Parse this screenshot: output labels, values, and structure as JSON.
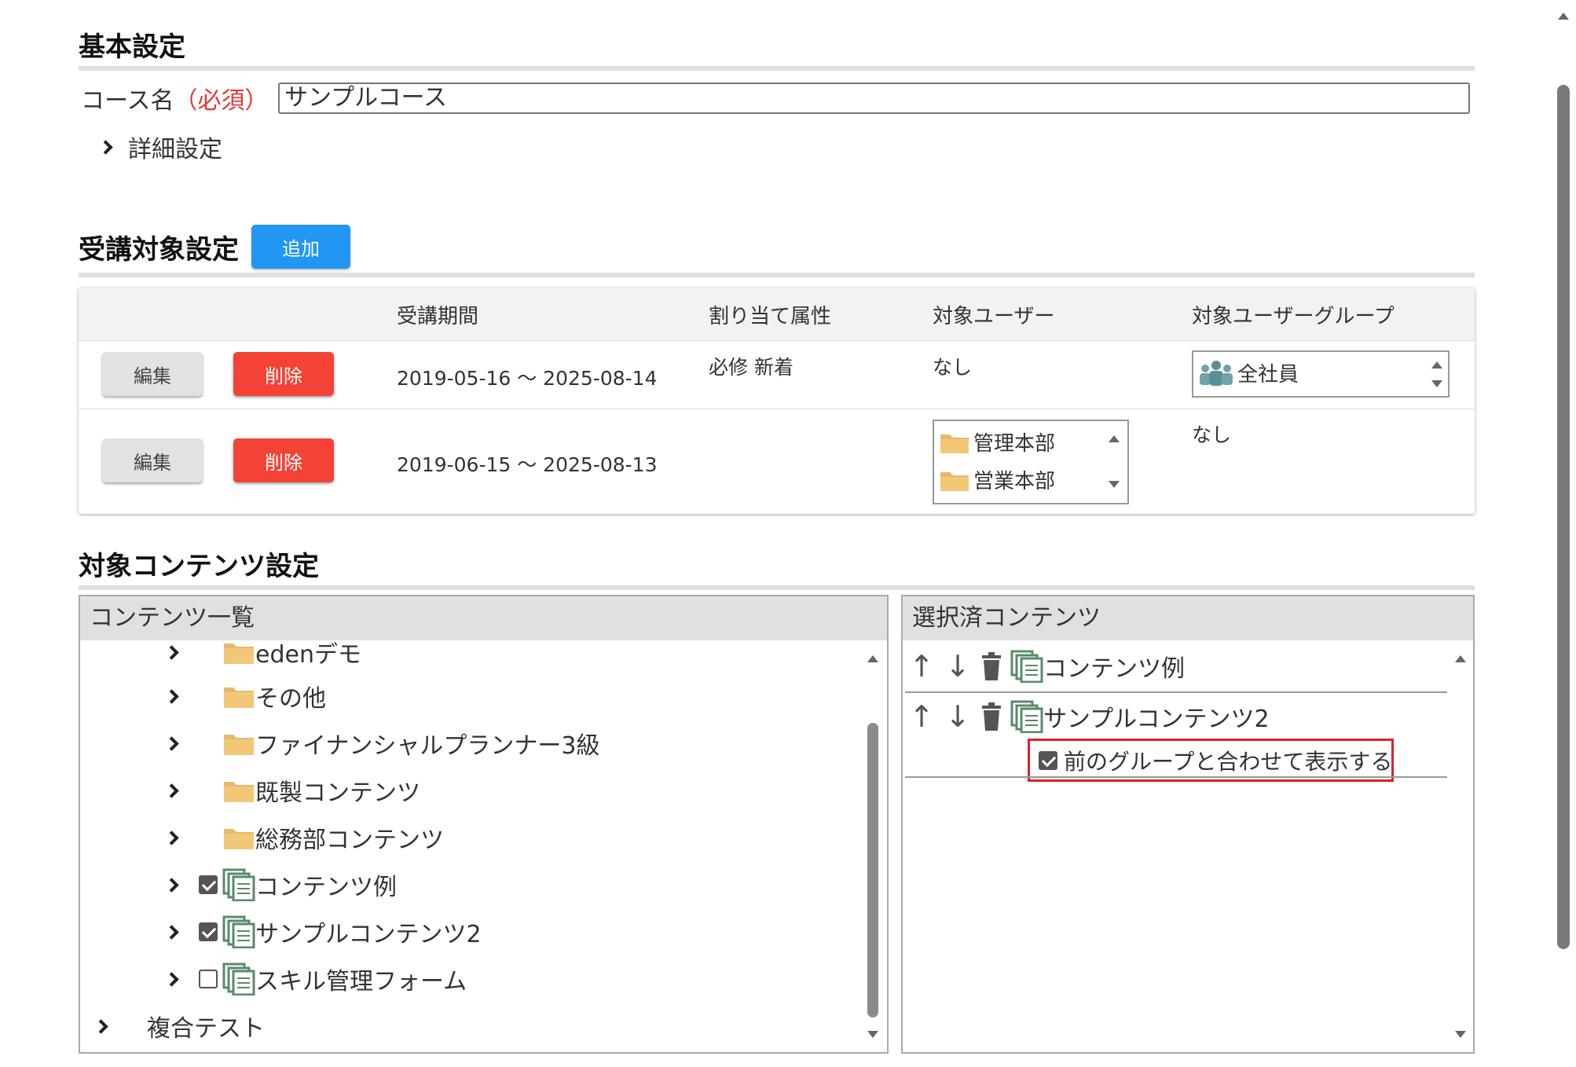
{
  "basic": {
    "title": "基本設定",
    "course_label": "コース名",
    "required_label": "（必須）",
    "course_value": "サンプルコース",
    "detail_label": "詳細設定"
  },
  "target": {
    "title": "受講対象設定",
    "add_label": "追加",
    "headers": [
      "受講期間",
      "割り当て属性",
      "対象ユーザー",
      "対象ユーザーグループ"
    ],
    "edit_label": "編集",
    "delete_label": "削除",
    "rows": [
      {
        "period": "2019-05-16 ～ 2025-08-14",
        "attribute": "必修 新着",
        "users": "なし",
        "group_items": [
          "全社員"
        ]
      },
      {
        "period": "2019-06-15 ～ 2025-08-13",
        "attribute": "",
        "user_items": [
          "管理本部",
          "営業本部"
        ],
        "groups": "なし"
      }
    ]
  },
  "contents": {
    "title": "対象コンテンツ設定",
    "list_header": "コンテンツ一覧",
    "selected_header": "選択済コンテンツ",
    "tree": [
      {
        "label": "edenデモ",
        "type": "folder"
      },
      {
        "label": "その他",
        "type": "folder"
      },
      {
        "label": "ファイナンシャルプランナー3級",
        "type": "folder"
      },
      {
        "label": "既製コンテンツ",
        "type": "folder"
      },
      {
        "label": "総務部コンテンツ",
        "type": "folder"
      },
      {
        "label": "コンテンツ例",
        "type": "content",
        "checked": true
      },
      {
        "label": "サンプルコンテンツ2",
        "type": "content",
        "checked": true
      },
      {
        "label": "スキル管理フォーム",
        "type": "content",
        "checked": false
      },
      {
        "label": "複合テスト",
        "type": "group"
      }
    ],
    "selected": [
      {
        "label": "コンテンツ例"
      },
      {
        "label": "サンプルコンテンツ2",
        "combine_label": "前のグループと合わせて表示する",
        "combine_checked": true
      }
    ]
  },
  "colors": {
    "accent": "#2196f3",
    "danger": "#f44336",
    "folder": "#e8b86a",
    "content_icon": "#5a8a6a",
    "highlight": "#e0202a"
  }
}
